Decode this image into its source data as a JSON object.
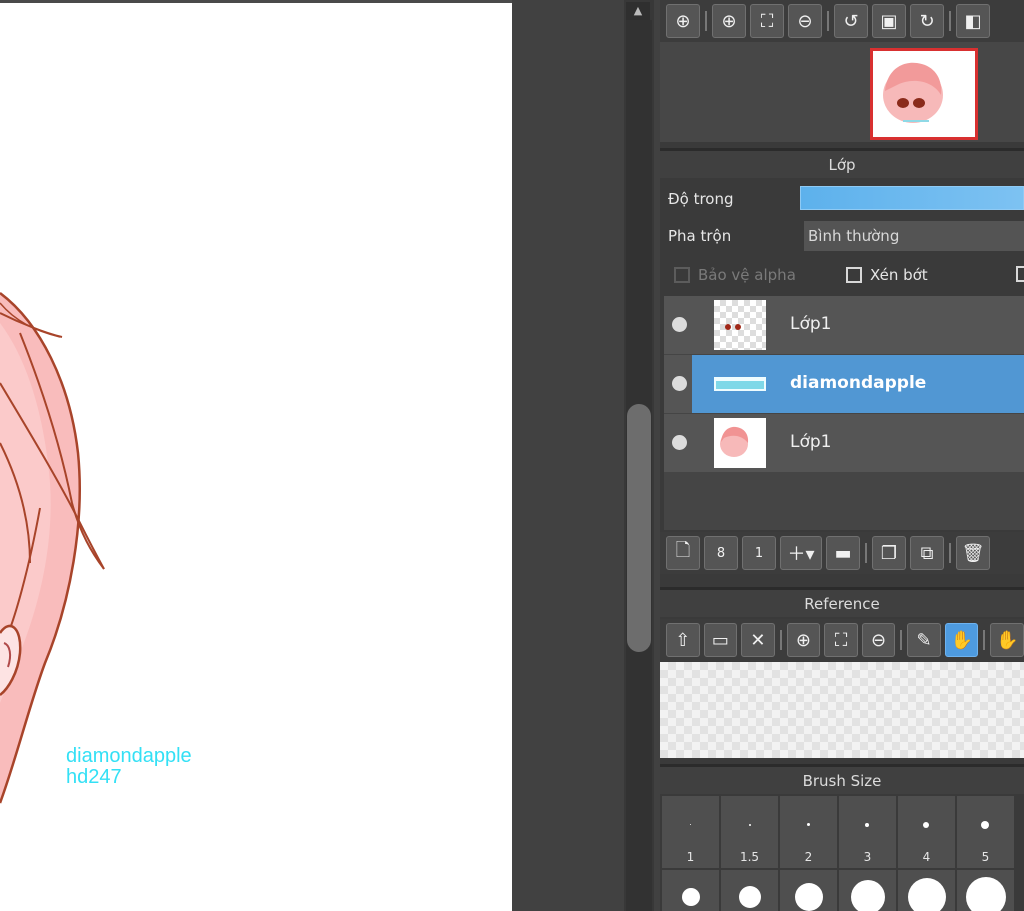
{
  "canvas": {
    "watermark_line1": "diamondapple",
    "watermark_line2": "hd247",
    "watermark_color": "#33e0f5"
  },
  "toolbar_top": {
    "buttons": [
      "zoom-actual-icon",
      "zoom-in-icon",
      "fit-icon",
      "zoom-out-icon",
      "rotate-left-icon",
      "reset-view-icon",
      "rotate-right-icon",
      "flip-icon"
    ]
  },
  "layer_panel": {
    "title": "Lớp",
    "opacity_label": "Độ trong",
    "opacity_value": 100,
    "blend_label": "Pha trộn",
    "blend_value": "Bình thường",
    "protect_alpha": "Bảo vệ alpha",
    "clipping": "Xén bớt",
    "layers": [
      {
        "name": "Lớp1",
        "selected": false
      },
      {
        "name": "diamondapple",
        "selected": true
      },
      {
        "name": "Lớp1",
        "selected": false
      }
    ],
    "accent": "#5197d3"
  },
  "reference_panel": {
    "title": "Reference"
  },
  "brush_panel": {
    "title": "Brush Size",
    "sizes": [
      "1",
      "1.5",
      "2",
      "3",
      "4",
      "5"
    ]
  }
}
